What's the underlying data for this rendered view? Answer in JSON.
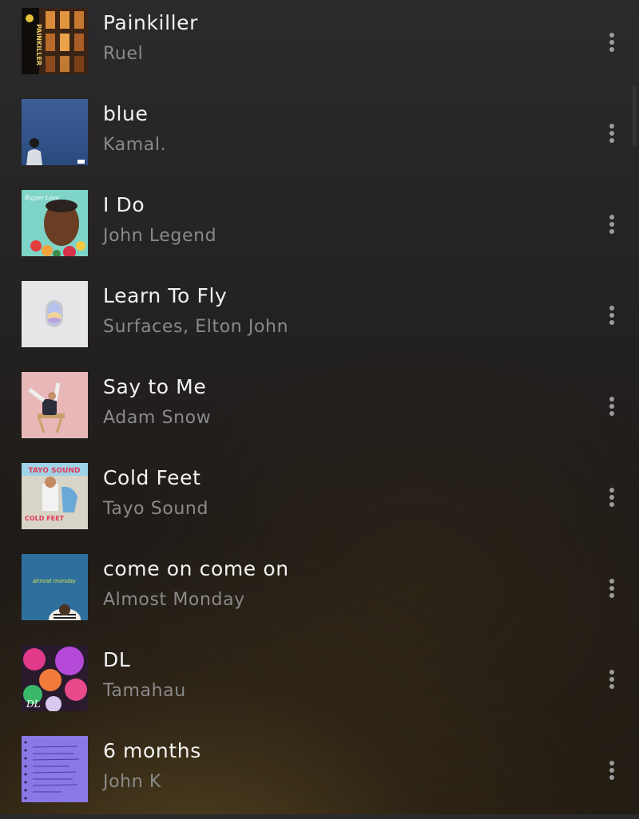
{
  "tracks": [
    {
      "title": "Painkiller",
      "artist": "Ruel",
      "cover_text": "PAINKILLER"
    },
    {
      "title": "blue",
      "artist": "Kamal."
    },
    {
      "title": "I Do",
      "artist": "John Legend",
      "cover_text": "Bigger Love"
    },
    {
      "title": "Learn To Fly",
      "artist": "Surfaces, Elton John"
    },
    {
      "title": "Say to Me",
      "artist": "Adam Snow"
    },
    {
      "title": "Cold Feet",
      "artist": "Tayo Sound",
      "cover_text": "TAYO SOUND",
      "cover_text_2": "COLD FEET"
    },
    {
      "title": "come on come on",
      "artist": "Almost Monday",
      "cover_text": "almost monday"
    },
    {
      "title": "DL",
      "artist": "Tamahau",
      "cover_text": "DL"
    },
    {
      "title": "6 months",
      "artist": "John K"
    }
  ],
  "icons": {
    "more": "more-vertical-icon"
  },
  "colors": {
    "title": "#f2f2f2",
    "artist": "#8a8a8a",
    "more_icon": "#9c9c9c"
  }
}
